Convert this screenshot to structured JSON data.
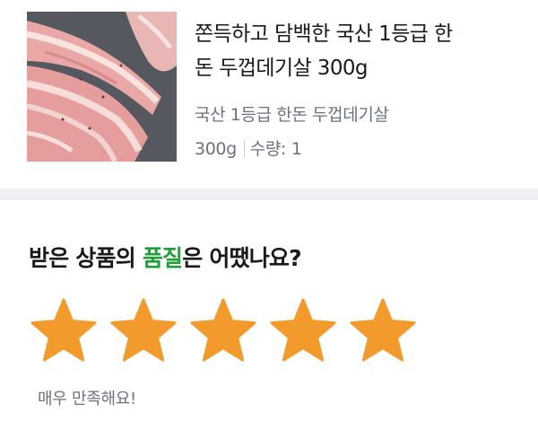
{
  "product": {
    "title_line1": "쫀득하고 담백한 국산 1등급 한",
    "title_line2": "돈 두껍데기살 300g",
    "subtitle": "국산 1등급 한돈 두껍데기살",
    "weight": "300g",
    "quantity_label": "수량:",
    "quantity_value": "1",
    "image_icon": "pork-meat-photo"
  },
  "review": {
    "question_prefix": "받은 상품의 ",
    "question_accent": "품질",
    "question_suffix": "은 어땠나요?",
    "rating": 5,
    "max_rating": 5,
    "feedback": "매우 만족해요!"
  },
  "colors": {
    "star": "#f39a2c",
    "accent": "#1f9e3a",
    "divider": "#eef0f3",
    "muted_text": "#6b7280"
  }
}
